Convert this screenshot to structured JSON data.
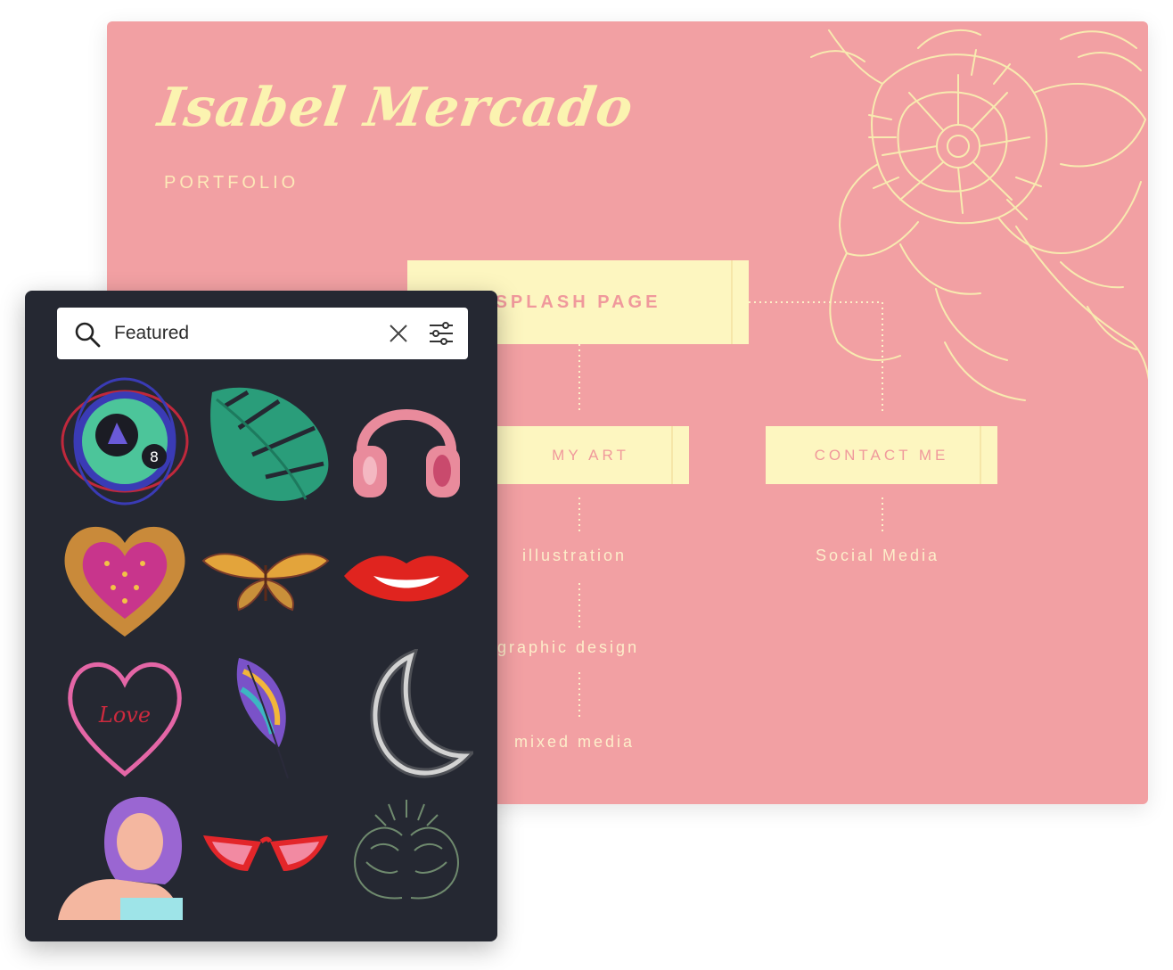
{
  "design": {
    "title": "Isabel Mercado",
    "subtitle": "PORTFOLIO",
    "nodes": {
      "splash": "SPLASH PAGE",
      "my_art": "MY ART",
      "contact": "CONTACT ME"
    },
    "leaves": [
      "illustration",
      "graphic design",
      "mixed media",
      "Social Media"
    ],
    "colors": {
      "background": "#f2a0a3",
      "title": "#fbf3b0",
      "node_fill": "#fdf6c0",
      "node_text": "#f0999c"
    }
  },
  "panel": {
    "search": {
      "value": "Featured",
      "icon": "search-icon",
      "clear_icon": "close-icon",
      "filter_icon": "filter-sliders-icon"
    },
    "stickers": [
      "magic-8-ball-badge",
      "monstera-leaf",
      "pink-headphones",
      "strawberry-heart",
      "butterfly",
      "red-lips",
      "love-heart-outline",
      "rainbow-feather",
      "neon-crescent-moon",
      "purple-hair-woman",
      "red-sunglasses",
      "gemini-twins-line-art"
    ],
    "colors": {
      "background": "#252832"
    }
  }
}
